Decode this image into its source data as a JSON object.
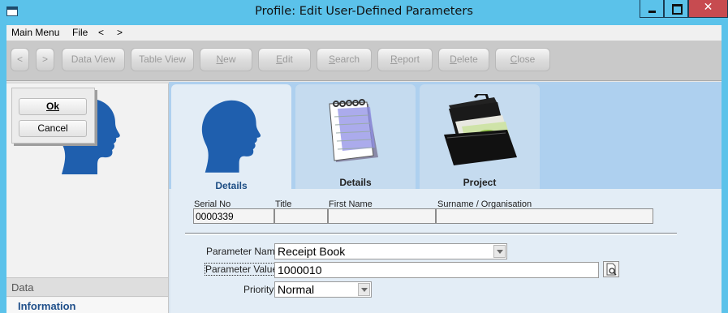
{
  "window": {
    "title": "Profile: Edit User-Defined Parameters",
    "close_glyph": "✕"
  },
  "menu": {
    "main_menu": "Main Menu",
    "file": "File",
    "back": "<",
    "forward": ">"
  },
  "toolbar": {
    "back": "<",
    "forward": ">",
    "data_view": "Data View",
    "table_view": "Table View",
    "new": "New",
    "edit": "Edit",
    "search": "Search",
    "report": "Report",
    "delete": "Delete",
    "close": "Close"
  },
  "dialog": {
    "ok": "Ok",
    "cancel": "Cancel"
  },
  "left_panel": {
    "section": "Data",
    "item": "Information"
  },
  "tabs": [
    {
      "label": "Details",
      "icon": "head-silhouette-icon",
      "active": true
    },
    {
      "label": "Details",
      "icon": "notepad-icon",
      "active": false
    },
    {
      "label": "Project",
      "icon": "briefcase-icon",
      "active": false
    }
  ],
  "record": {
    "serial_label": "Serial No",
    "serial_value": "0000339",
    "title_label": "Title",
    "title_value": "",
    "first_name_label": "First Name",
    "first_name_value": "",
    "surname_label": "Surname / Organisation",
    "surname_value": ""
  },
  "params": {
    "name_label": "Parameter Name",
    "name_value": "Receipt Book",
    "value_label": "Parameter Value",
    "value_value": "1000010",
    "priority_label": "Priority",
    "priority_value": "Normal"
  },
  "colors": {
    "titlebar": "#5bc2ea",
    "close_button": "#c74b50",
    "tab_strip": "#aed0ef",
    "form_bg": "#e3edf6",
    "head_icon": "#1f5fae"
  }
}
